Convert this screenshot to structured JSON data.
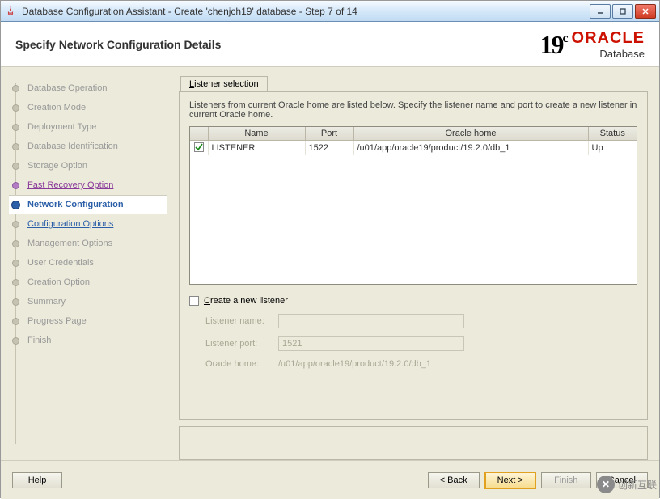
{
  "window": {
    "title": "Database Configuration Assistant - Create 'chenjch19' database - Step 7 of 14"
  },
  "header": {
    "page_title": "Specify Network Configuration Details",
    "brand_version": "19",
    "brand_suffix": "c",
    "brand_name": "ORACLE",
    "brand_product": "Database"
  },
  "sidebar": {
    "steps": [
      {
        "label": "Database Operation",
        "state": "done"
      },
      {
        "label": "Creation Mode",
        "state": "done"
      },
      {
        "label": "Deployment Type",
        "state": "done"
      },
      {
        "label": "Database Identification",
        "state": "done"
      },
      {
        "label": "Storage Option",
        "state": "done"
      },
      {
        "label": "Fast Recovery Option",
        "state": "visited"
      },
      {
        "label": "Network Configuration",
        "state": "current"
      },
      {
        "label": "Configuration Options",
        "state": "next"
      },
      {
        "label": "Management Options",
        "state": "pending"
      },
      {
        "label": "User Credentials",
        "state": "pending"
      },
      {
        "label": "Creation Option",
        "state": "pending"
      },
      {
        "label": "Summary",
        "state": "pending"
      },
      {
        "label": "Progress Page",
        "state": "pending"
      },
      {
        "label": "Finish",
        "state": "pending"
      }
    ]
  },
  "main": {
    "tab_label_pre": "L",
    "tab_label_rest": "istener selection",
    "instruction": "Listeners from current Oracle home are listed below. Specify the listener name and port to create a new listener in current Oracle home.",
    "table": {
      "cols": {
        "check": "",
        "name": "Name",
        "port": "Port",
        "home": "Oracle home",
        "status": "Status"
      },
      "rows": [
        {
          "checked": true,
          "name": "LISTENER",
          "port": "1522",
          "home": "/u01/app/oracle19/product/19.2.0/db_1",
          "status": "Up"
        }
      ]
    },
    "create_new": {
      "checked": false,
      "label_pre": "C",
      "label_rest": "reate a new listener",
      "listener_name_label": "Listener name:",
      "listener_name_value": "",
      "listener_port_label": "Listener port:",
      "listener_port_value": "1521",
      "oracle_home_label": "Oracle home:",
      "oracle_home_value": "/u01/app/oracle19/product/19.2.0/db_1"
    }
  },
  "footer": {
    "help": "Help",
    "back": "< Back",
    "next_pre": "N",
    "next_rest": "ext >",
    "finish": "Finish",
    "cancel": "Cancel"
  },
  "watermark": "创新互联"
}
